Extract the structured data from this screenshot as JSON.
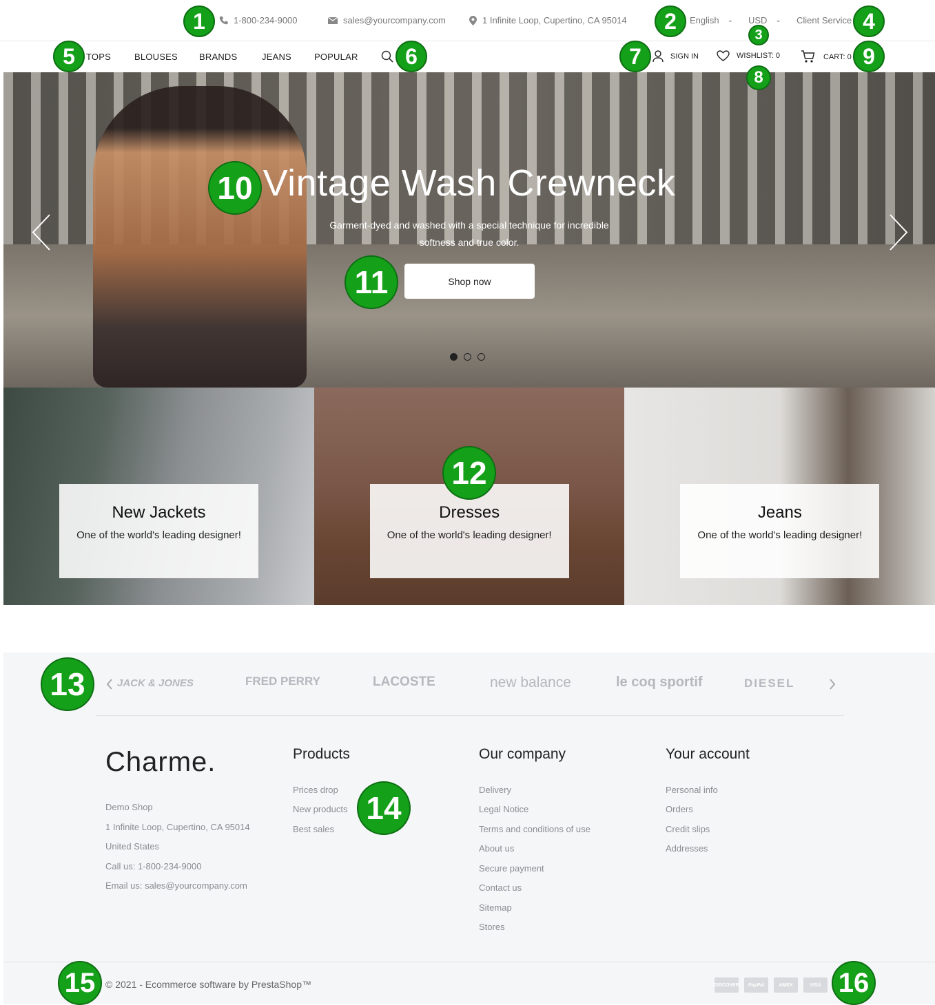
{
  "topbar": {
    "phone": "1-800-234-9000",
    "email": "sales@yourcompany.com",
    "address": "1 Infinite Loop, Cupertino, CA 95014",
    "language": "English",
    "currency": "USD",
    "client_service": "Client Service"
  },
  "nav": {
    "items": [
      "TOPS",
      "BLOUSES",
      "BRANDS",
      "JEANS",
      "POPULAR"
    ],
    "sign_in": "SIGN IN",
    "wishlist": "WISHLIST: 0",
    "cart": "CART: 0"
  },
  "hero": {
    "title": "Vintage Wash Crewneck",
    "subtitle": "Garment-dyed and washed with a special technique for incredible softness and true color.",
    "button": "Shop now",
    "slides": 3,
    "active_slide": 1
  },
  "banners": [
    {
      "title": "New Jackets",
      "text": "One of the world's leading designer!"
    },
    {
      "title": "Dresses",
      "text": "One of the world's leading designer!"
    },
    {
      "title": "Jeans",
      "text": "One of the world's leading designer!"
    }
  ],
  "brands": [
    "JACK & JONES",
    "FRED PERRY",
    "LACOSTE",
    "new balance",
    "le coq sportif",
    "DIESEL"
  ],
  "footer": {
    "logo": "Charme.",
    "store": [
      "Demo Shop",
      "1 Infinite Loop, Cupertino, CA 95014",
      "United States",
      "Call us: 1-800-234-9000",
      "Email us: sales@yourcompany.com"
    ],
    "products_title": "Products",
    "products": [
      "Prices drop",
      "New products",
      "Best sales"
    ],
    "company_title": "Our company",
    "company": [
      "Delivery",
      "Legal Notice",
      "Terms and conditions of use",
      "About us",
      "Secure payment",
      "Contact us",
      "Sitemap",
      "Stores"
    ],
    "account_title": "Your account",
    "account": [
      "Personal info",
      "Orders",
      "Credit slips",
      "Addresses"
    ]
  },
  "bottom": {
    "copyright": "© 2021 - Ecommerce software by PrestaShop™",
    "payments": [
      "DISCOVER",
      "PayPal",
      "AMEX",
      "VISA"
    ]
  },
  "annotations": [
    "1",
    "2",
    "3",
    "4",
    "5",
    "6",
    "7",
    "8",
    "9",
    "10",
    "11",
    "12",
    "13",
    "14",
    "15",
    "16"
  ],
  "colors": {
    "badge": "#14a019",
    "footer_bg": "#f4f6f8"
  }
}
